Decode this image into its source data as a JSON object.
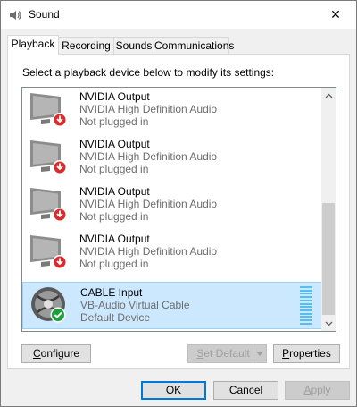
{
  "window": {
    "title": "Sound",
    "close_glyph": "✕"
  },
  "tabs": [
    {
      "label": "Playback"
    },
    {
      "label": "Recording"
    },
    {
      "label": "Sounds"
    },
    {
      "label": "Communications"
    }
  ],
  "instruction": "Select a playback device below to modify its settings:",
  "devices": [
    {
      "name": "NVIDIA Output",
      "driver": "NVIDIA High Definition Audio",
      "status": "Not plugged in",
      "badge": "unplugged-arrow"
    },
    {
      "name": "NVIDIA Output",
      "driver": "NVIDIA High Definition Audio",
      "status": "Not plugged in",
      "badge": "unplugged-arrow"
    },
    {
      "name": "NVIDIA Output",
      "driver": "NVIDIA High Definition Audio",
      "status": "Not plugged in",
      "badge": "unplugged-arrow"
    },
    {
      "name": "NVIDIA Output",
      "driver": "NVIDIA High Definition Audio",
      "status": "Not plugged in",
      "badge": "unplugged-arrow"
    },
    {
      "name": "CABLE Input",
      "driver": "VB-Audio Virtual Cable",
      "status": "Default Device",
      "badge": "default-check",
      "selected": true
    }
  ],
  "buttons": {
    "configure": {
      "access_key": "C",
      "rest": "onfigure"
    },
    "set_default": {
      "access_key": "S",
      "rest": "et Default"
    },
    "properties": {
      "access_key": "P",
      "rest": "roperties"
    },
    "ok": "OK",
    "cancel": "Cancel",
    "apply": {
      "access_key": "A",
      "rest": "pply"
    }
  },
  "colors": {
    "selection_bg": "#cce8ff",
    "selection_border": "#99d1ff",
    "unplugged_badge": "#d92b2b",
    "default_badge": "#1e9e3a",
    "meter": "#55c0ee",
    "accent_border": "#0078d7"
  }
}
